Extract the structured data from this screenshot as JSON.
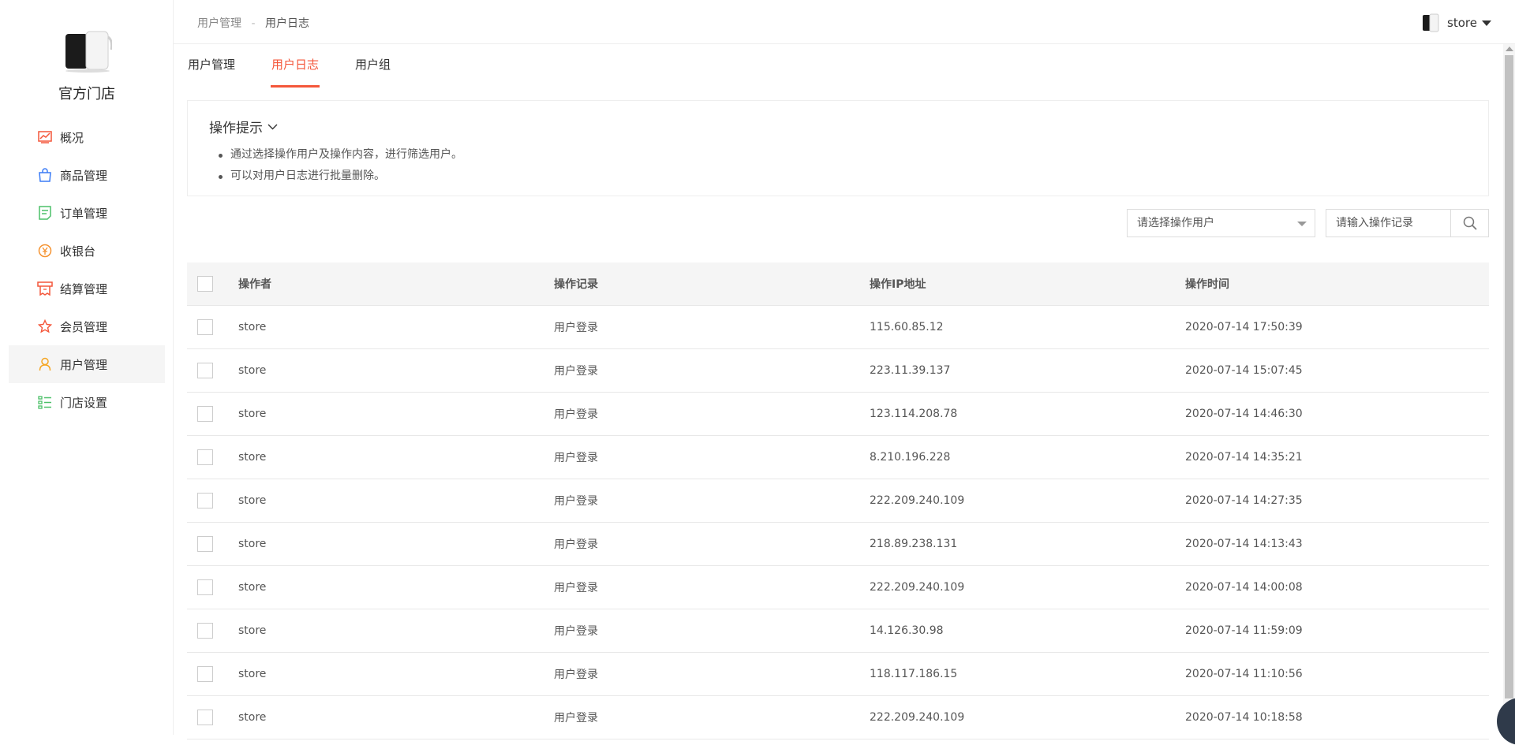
{
  "sidebar": {
    "store_name": "官方门店",
    "items": [
      {
        "label": "概况",
        "icon": "chart-icon",
        "color": "#f4563a"
      },
      {
        "label": "商品管理",
        "icon": "shopping-bag-icon",
        "color": "#3b7cf6"
      },
      {
        "label": "订单管理",
        "icon": "order-list-icon",
        "color": "#4cc068"
      },
      {
        "label": "收银台",
        "icon": "cashier-icon",
        "color": "#f5922f"
      },
      {
        "label": "结算管理",
        "icon": "settlement-icon",
        "color": "#f4563a"
      },
      {
        "label": "会员管理",
        "icon": "member-star-icon",
        "color": "#f4563a"
      },
      {
        "label": "用户管理",
        "icon": "user-icon",
        "color": "#f5a623"
      },
      {
        "label": "门店设置",
        "icon": "store-settings-icon",
        "color": "#4cc068"
      }
    ],
    "active_index": 6
  },
  "header": {
    "breadcrumb": [
      "用户管理",
      "用户日志"
    ],
    "breadcrumb_sep": "-",
    "username": "store"
  },
  "tabs": [
    {
      "label": "用户管理"
    },
    {
      "label": "用户日志"
    },
    {
      "label": "用户组"
    }
  ],
  "active_tab": 1,
  "tips": {
    "title": "操作提示",
    "items": [
      "通过选择操作用户及操作内容，进行筛选用户。",
      "可以对用户日志进行批量删除。"
    ]
  },
  "filters": {
    "user_select_placeholder": "请选择操作用户",
    "search_placeholder": "请输入操作记录"
  },
  "table": {
    "headers": [
      "操作者",
      "操作记录",
      "操作IP地址",
      "操作时间"
    ],
    "rows": [
      [
        "store",
        "用户登录",
        "115.60.85.12",
        "2020-07-14 17:50:39"
      ],
      [
        "store",
        "用户登录",
        "223.11.39.137",
        "2020-07-14 15:07:45"
      ],
      [
        "store",
        "用户登录",
        "123.114.208.78",
        "2020-07-14 14:46:30"
      ],
      [
        "store",
        "用户登录",
        "8.210.196.228",
        "2020-07-14 14:35:21"
      ],
      [
        "store",
        "用户登录",
        "222.209.240.109",
        "2020-07-14 14:27:35"
      ],
      [
        "store",
        "用户登录",
        "218.89.238.131",
        "2020-07-14 14:13:43"
      ],
      [
        "store",
        "用户登录",
        "222.209.240.109",
        "2020-07-14 14:00:08"
      ],
      [
        "store",
        "用户登录",
        "14.126.30.98",
        "2020-07-14 11:59:09"
      ],
      [
        "store",
        "用户登录",
        "118.117.186.15",
        "2020-07-14 11:10:56"
      ],
      [
        "store",
        "用户登录",
        "222.209.240.109",
        "2020-07-14 10:18:58"
      ]
    ]
  },
  "colors": {
    "accent": "#f4563a"
  }
}
